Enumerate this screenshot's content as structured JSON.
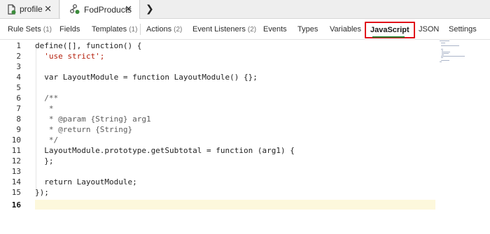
{
  "file_tabs": [
    {
      "label": "profile",
      "icon": "document-icon"
    },
    {
      "label": "FodProducts",
      "icon": "flow-icon"
    }
  ],
  "sub_tabs": [
    {
      "label": "Rule Sets",
      "count": "(1)"
    },
    {
      "label": "Fields",
      "count": ""
    },
    {
      "label": "Templates",
      "count": "(1)"
    },
    {
      "label": "Actions",
      "count": "(2)"
    },
    {
      "label": "Event Listeners",
      "count": "(2)"
    },
    {
      "label": "Events",
      "count": ""
    },
    {
      "label": "Types",
      "count": ""
    },
    {
      "label": "Variables",
      "count": ""
    },
    {
      "label": "JavaScript",
      "count": "",
      "active": true
    },
    {
      "label": "JSON",
      "count": ""
    },
    {
      "label": "Settings",
      "count": ""
    }
  ],
  "code_lines": [
    {
      "n": "1",
      "text": "define([], function() {"
    },
    {
      "n": "2",
      "text": "  'use strict';"
    },
    {
      "n": "3",
      "text": ""
    },
    {
      "n": "4",
      "text": "  var LayoutModule = function LayoutModule() {};"
    },
    {
      "n": "5",
      "text": ""
    },
    {
      "n": "6",
      "text": "  /**"
    },
    {
      "n": "7",
      "text": "   *"
    },
    {
      "n": "8",
      "text": "   * @param {String} arg1"
    },
    {
      "n": "9",
      "text": "   * @return {String}"
    },
    {
      "n": "10",
      "text": "   */"
    },
    {
      "n": "11",
      "text": "  LayoutModule.prototype.getSubtotal = function (arg1) {"
    },
    {
      "n": "12",
      "text": "  };"
    },
    {
      "n": "13",
      "text": ""
    },
    {
      "n": "14",
      "text": "  return LayoutModule;"
    },
    {
      "n": "15",
      "text": "});"
    },
    {
      "n": "16",
      "text": ""
    }
  ],
  "current_line": 16,
  "colors": {
    "active_tab_border": "#e0101a",
    "active_tab_underline": "#2f7d32",
    "current_line_highlight": "#fdf8dc"
  }
}
